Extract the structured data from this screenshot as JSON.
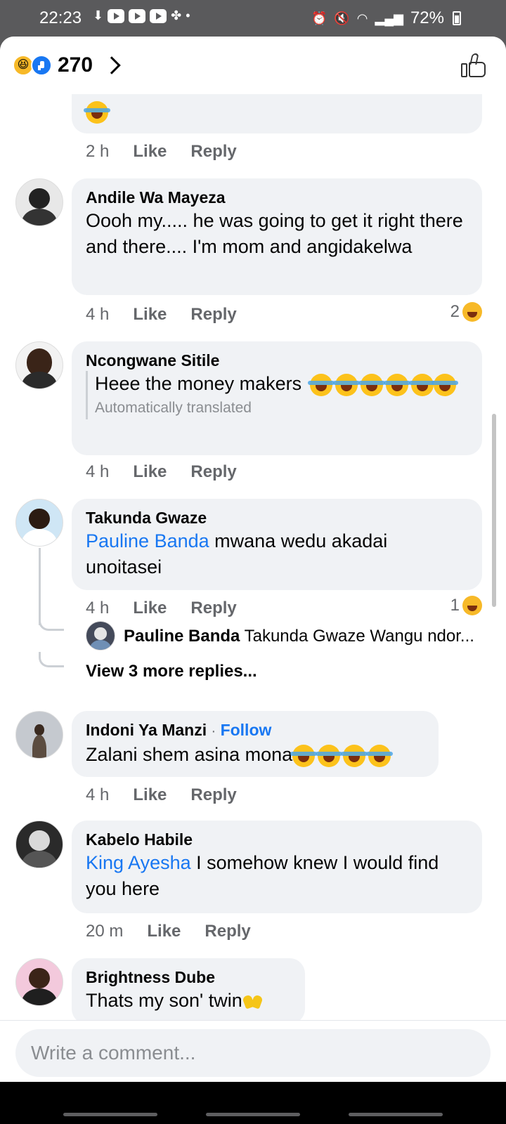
{
  "status_bar": {
    "time": "22:23",
    "battery": "72%"
  },
  "header": {
    "reaction_count": "270"
  },
  "comments": [
    {
      "author": "",
      "time": "2 h",
      "like": "Like",
      "reply": "Reply"
    },
    {
      "author": "Andile Wa Mayeza",
      "text": "Oooh my..... he was going to get it right there and there.... I'm mom and angidakelwa",
      "time": "4 h",
      "like": "Like",
      "reply": "Reply",
      "reaction_count": "2"
    },
    {
      "author": "Ncongwane Sitile",
      "text": "Heee the money makers",
      "translated_label": "Automatically translated",
      "time": "4 h",
      "like": "Like",
      "reply": "Reply"
    },
    {
      "author": "Takunda Gwaze",
      "mention": "Pauline Banda",
      "text": " mwana wedu akadai unoitasei",
      "time": "4 h",
      "like": "Like",
      "reply": "Reply",
      "reaction_count": "1",
      "reply_preview": {
        "author": "Pauline Banda",
        "text": "Takunda Gwaze Wangu ndor..."
      },
      "view_more": "View 3 more replies..."
    },
    {
      "author": "Indoni Ya Manzi",
      "follow": "Follow",
      "text": "Zalani shem asina mona",
      "time": "4 h",
      "like": "Like",
      "reply": "Reply"
    },
    {
      "author": "Kabelo Habile",
      "mention": "King Ayesha",
      "text": " I  somehow knew I would find you here",
      "time": "20 m",
      "like": "Like",
      "reply": "Reply"
    },
    {
      "author": "Brightness Dube",
      "text": "Thats my son' twin"
    }
  ],
  "composer": {
    "placeholder": "Write a comment..."
  },
  "colors": {
    "link": "#1877f2",
    "bubble": "#f0f2f5",
    "meta": "#65676b"
  },
  "icons": [
    "haha-reaction-icon",
    "like-reaction-icon",
    "chevron-right-icon",
    "thumbs-up-icon",
    "tears-of-joy-emoji",
    "clapping-hands-emoji"
  ]
}
